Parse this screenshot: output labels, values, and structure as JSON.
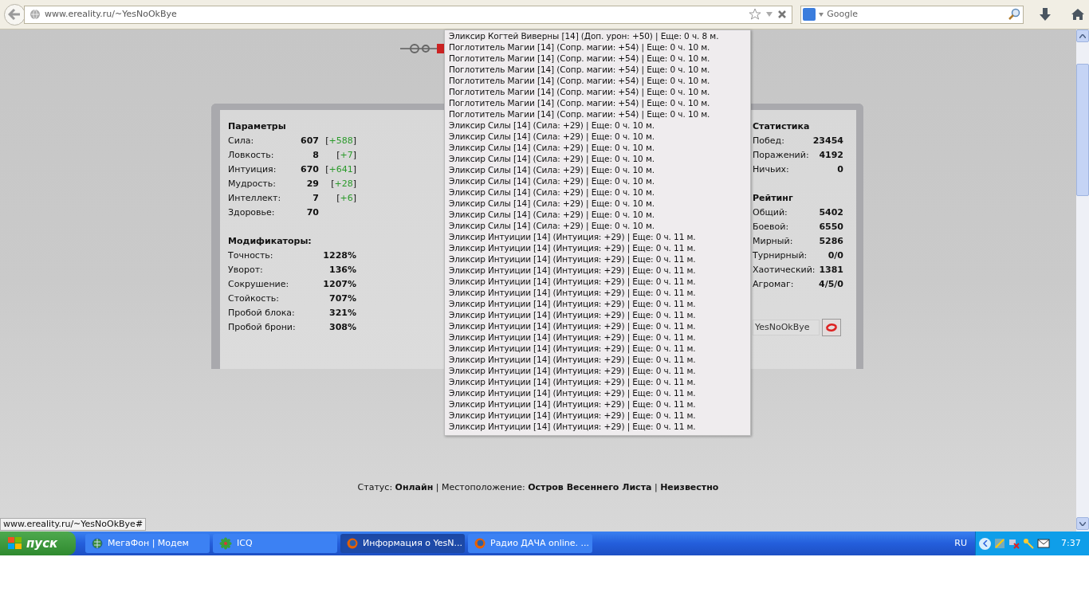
{
  "browser": {
    "url": "www.ereality.ru/~YesNoOkBye",
    "search": {
      "placeholder": "Google"
    }
  },
  "parameters": {
    "title": "Параметры",
    "rows": [
      {
        "label": "Сила:",
        "value": "607",
        "bonus": [
          "[",
          "+588",
          "]"
        ]
      },
      {
        "label": "Ловкость:",
        "value": "8",
        "bonus": [
          "[",
          "+7",
          "]"
        ]
      },
      {
        "label": "Интуиция:",
        "value": "670",
        "bonus": [
          "[",
          "+641",
          "]"
        ]
      },
      {
        "label": "Мудрость:",
        "value": "29",
        "bonus": [
          "[",
          "+28",
          "]"
        ]
      },
      {
        "label": "Интеллект:",
        "value": "7",
        "bonus": [
          "[",
          "+6",
          "]"
        ]
      },
      {
        "label": "Здоровье:",
        "value": "70"
      }
    ]
  },
  "modifiers": {
    "title": "Модификаторы:",
    "rows": [
      {
        "label": "Точность:",
        "value": "1228%"
      },
      {
        "label": "Уворот:",
        "value": "136%"
      },
      {
        "label": "Сокрушение:",
        "value": "1207%"
      },
      {
        "label": "Стойкость:",
        "value": "707%"
      },
      {
        "label": "Пробой блока:",
        "value": "321%"
      },
      {
        "label": "Пробой брони:",
        "value": "308%"
      }
    ]
  },
  "statistics": {
    "title": "Статистика",
    "rows": [
      {
        "label": "Побед:",
        "value": "23454"
      },
      {
        "label": "Поражений:",
        "value": "4192"
      },
      {
        "label": "Ничьих:",
        "value": "0"
      }
    ]
  },
  "rating": {
    "title": "Рейтинг",
    "rows": [
      {
        "label": "Общий:",
        "value": "5402"
      },
      {
        "label": "Боевой:",
        "value": "6550"
      },
      {
        "label": "Мирный:",
        "value": "5286"
      },
      {
        "label": "Турнирный:",
        "value": "0/0"
      },
      {
        "label": "Хаотический:",
        "value": "1381"
      },
      {
        "label": "Агромаг:",
        "value": "4/5/0"
      }
    ]
  },
  "name_field": {
    "value": "YesNoOkBye"
  },
  "effects_tooltip": [
    "Эликсир Когтей Виверны [14] (Доп. урон: +50) | Еще: 0 ч. 8 м.",
    "Поглотитель Магии [14] (Сопр. магии: +54) | Еще: 0 ч. 10 м.",
    "Поглотитель Магии [14] (Сопр. магии: +54) | Еще: 0 ч. 10 м.",
    "Поглотитель Магии [14] (Сопр. магии: +54) | Еще: 0 ч. 10 м.",
    "Поглотитель Магии [14] (Сопр. магии: +54) | Еще: 0 ч. 10 м.",
    "Поглотитель Магии [14] (Сопр. магии: +54) | Еще: 0 ч. 10 м.",
    "Поглотитель Магии [14] (Сопр. магии: +54) | Еще: 0 ч. 10 м.",
    "Поглотитель Магии [14] (Сопр. магии: +54) | Еще: 0 ч. 10 м.",
    "Эликсир Силы [14] (Сила: +29) | Еще: 0 ч. 10 м.",
    "Эликсир Силы [14] (Сила: +29) | Еще: 0 ч. 10 м.",
    "Эликсир Силы [14] (Сила: +29) | Еще: 0 ч. 10 м.",
    "Эликсир Силы [14] (Сила: +29) | Еще: 0 ч. 10 м.",
    "Эликсир Силы [14] (Сила: +29) | Еще: 0 ч. 10 м.",
    "Эликсир Силы [14] (Сила: +29) | Еще: 0 ч. 10 м.",
    "Эликсир Силы [14] (Сила: +29) | Еще: 0 ч. 10 м.",
    "Эликсир Силы [14] (Сила: +29) | Еще: 0 ч. 10 м.",
    "Эликсир Силы [14] (Сила: +29) | Еще: 0 ч. 10 м.",
    "Эликсир Силы [14] (Сила: +29) | Еще: 0 ч. 10 м.",
    "Эликсир Интуиции [14] (Интуиция: +29) | Еще: 0 ч. 11 м.",
    "Эликсир Интуиции [14] (Интуиция: +29) | Еще: 0 ч. 11 м.",
    "Эликсир Интуиции [14] (Интуиция: +29) | Еще: 0 ч. 11 м.",
    "Эликсир Интуиции [14] (Интуиция: +29) | Еще: 0 ч. 11 м.",
    "Эликсир Интуиции [14] (Интуиция: +29) | Еще: 0 ч. 11 м.",
    "Эликсир Интуиции [14] (Интуиция: +29) | Еще: 0 ч. 11 м.",
    "Эликсир Интуиции [14] (Интуиция: +29) | Еще: 0 ч. 11 м.",
    "Эликсир Интуиции [14] (Интуиция: +29) | Еще: 0 ч. 11 м.",
    "Эликсир Интуиции [14] (Интуиция: +29) | Еще: 0 ч. 11 м.",
    "Эликсир Интуиции [14] (Интуиция: +29) | Еще: 0 ч. 11 м.",
    "Эликсир Интуиции [14] (Интуиция: +29) | Еще: 0 ч. 11 м.",
    "Эликсир Интуиции [14] (Интуиция: +29) | Еще: 0 ч. 11 м.",
    "Эликсир Интуиции [14] (Интуиция: +29) | Еще: 0 ч. 11 м.",
    "Эликсир Интуиции [14] (Интуиция: +29) | Еще: 0 ч. 11 м.",
    "Эликсир Интуиции [14] (Интуиция: +29) | Еще: 0 ч. 11 м.",
    "Эликсир Интуиции [14] (Интуиция: +29) | Еще: 0 ч. 11 м.",
    "Эликсир Интуиции [14] (Интуиция: +29) | Еще: 0 ч. 11 м.",
    "Эликсир Интуиции [14] (Интуиция: +29) | Еще: 0 ч. 11 м."
  ],
  "footer_status": "Статус: **Онлайн** | Местоположение: **Остров Весеннего Листа** | **Неизвестно**",
  "link_preview": "www.ereality.ru/~YesNoOkBye#",
  "taskbar": {
    "start": "пуск",
    "tasks": [
      {
        "label": "МегаФон | Модем",
        "kind": "globe",
        "selected": false
      },
      {
        "label": "ICQ",
        "kind": "flower",
        "selected": false
      },
      {
        "label": "Информация о YesN...",
        "kind": "firefox",
        "selected": true
      },
      {
        "label": "Радио ДАЧА online. ...",
        "kind": "firefox",
        "selected": false
      }
    ],
    "language": "RU",
    "clock": "7:37"
  }
}
